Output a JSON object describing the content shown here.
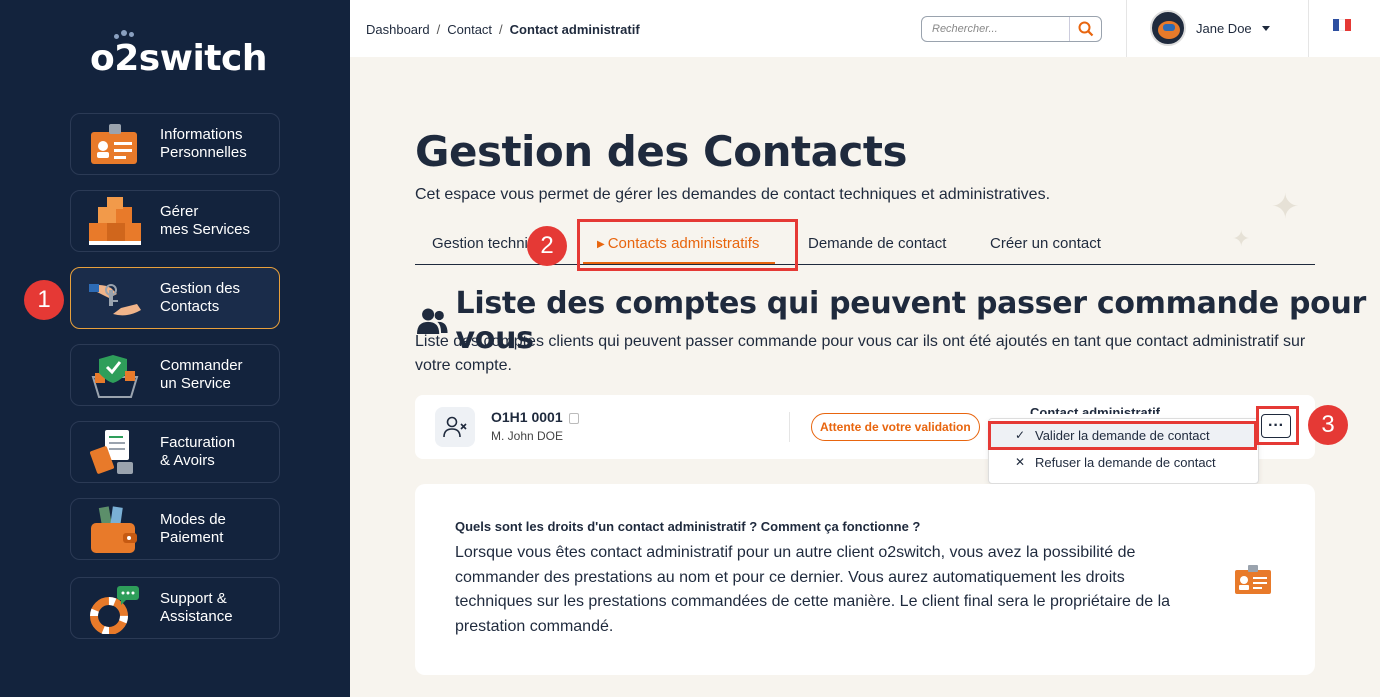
{
  "app": {
    "logo_text": "o2switch"
  },
  "sidebar": {
    "items": [
      {
        "label": "Informations\nPersonnelles",
        "icon": "id-card-icon"
      },
      {
        "label": "Gérer\nmes Services",
        "icon": "boxes-icon"
      },
      {
        "label": "Gestion des\nContacts",
        "icon": "handshake-key-icon",
        "active": true
      },
      {
        "label": "Commander\nun Service",
        "icon": "basket-shield-icon"
      },
      {
        "label": "Facturation\n& Avoirs",
        "icon": "invoice-icon"
      },
      {
        "label": "Modes de\nPaiement",
        "icon": "wallet-icon"
      },
      {
        "label": "Support &\nAssistance",
        "icon": "lifebuoy-chat-icon"
      }
    ]
  },
  "annotations": {
    "step1": "1",
    "step2": "2",
    "step3": "3"
  },
  "topbar": {
    "breadcrumb": [
      "Dashboard",
      "Contact",
      "Contact administratif"
    ],
    "breadcrumb_sep": "/",
    "search_placeholder": "Rechercher...",
    "user_name": "Jane Doe",
    "language": "FR"
  },
  "page": {
    "title": "Gestion des Contacts",
    "intro": "Cet espace vous permet de gérer les demandes de contact techniques et administratives.",
    "tabs": [
      {
        "label": "Gestion technique"
      },
      {
        "label": "Contacts administratifs",
        "active": true
      },
      {
        "label": "Demande de contact"
      },
      {
        "label": "Créer un contact"
      }
    ],
    "section_title": "Liste des comptes qui peuvent passer commande pour vous",
    "section_desc": "Liste des comptes clients qui peuvent passer commande pour vous car ils ont été ajoutés en tant que contact administratif sur votre compte."
  },
  "account": {
    "id": "O1H1 0001",
    "name": "M. John DOE",
    "status": "Attente de votre validation",
    "role": "Contact administratif",
    "more_label": "···"
  },
  "dropdown": {
    "items": [
      {
        "mark": "✓",
        "label": "Valider la demande de contact"
      },
      {
        "mark": "✕",
        "label": "Refuser la demande de contact"
      }
    ]
  },
  "info": {
    "question": "Quels sont les droits d'un contact administratif ? Comment ça fonctionne ?",
    "answer": "Lorsque vous êtes contact administratif pour un autre client o2switch, vous avez la possibilité de commander des prestations au nom et pour ce dernier. Vous aurez automatiquement les droits techniques sur les prestations commandées de cette manière. Le client final sera le propriétaire de la prestation commandé."
  },
  "colors": {
    "accent": "#e8650e",
    "sidebar_bg": "#13233d",
    "annotation": "#e53935"
  }
}
